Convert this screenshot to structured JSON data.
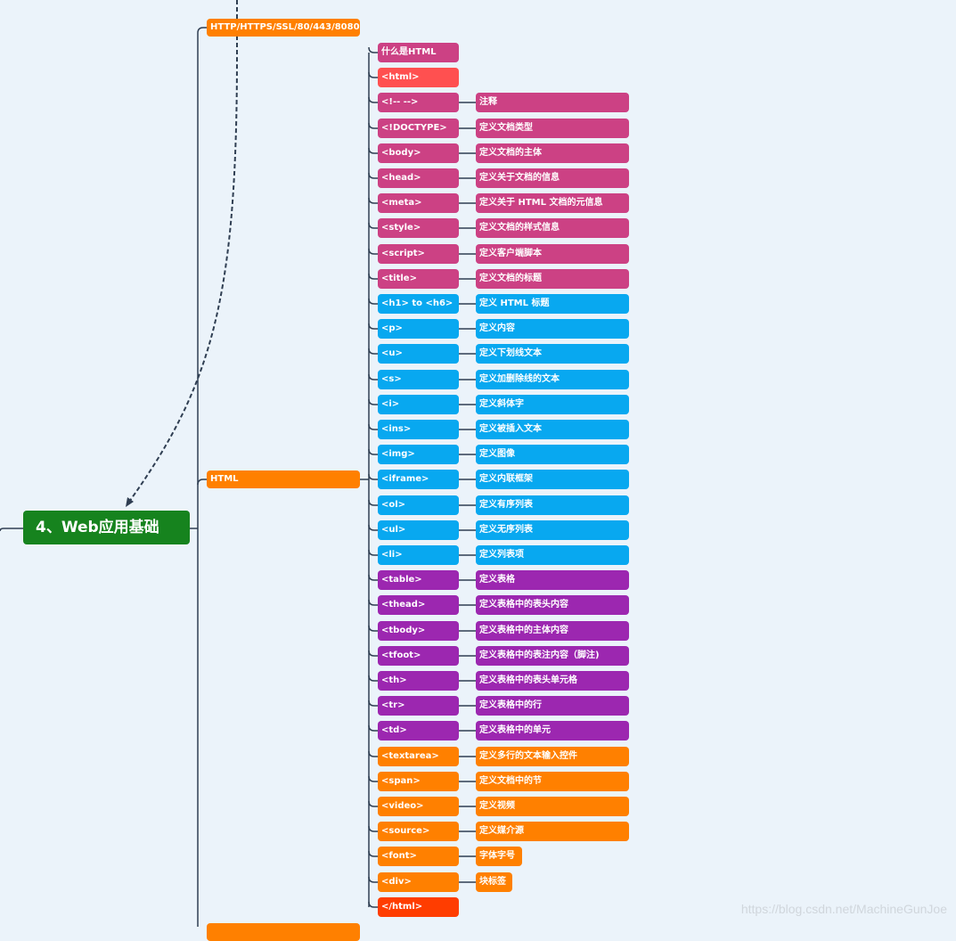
{
  "root": {
    "label": "4、Web应用基础",
    "color": "#16831e"
  },
  "colors": {
    "orange": "#ff8000",
    "pink": "#cc4184",
    "red": "#ff5050",
    "blue": "#08a8f0",
    "purple": "#9c27b0",
    "deep_red": "#ff3d00",
    "line": "#2f3e52"
  },
  "branches": [
    {
      "label": "HTTP/HTTPS/SSL/80/443/8080",
      "color": "orange"
    },
    {
      "label": "HTML",
      "color": "orange"
    },
    {
      "label": "",
      "color": "orange"
    }
  ],
  "html_children": [
    {
      "tag": "什么是HTML",
      "desc": "",
      "color": "pink"
    },
    {
      "tag": "<html>",
      "desc": "",
      "color": "red"
    },
    {
      "tag": "<!-- -->",
      "desc": "注释",
      "color": "pink"
    },
    {
      "tag": "<!DOCTYPE>",
      "desc": "定义文档类型",
      "color": "pink"
    },
    {
      "tag": "<body>",
      "desc": "定义文档的主体",
      "color": "pink"
    },
    {
      "tag": "<head>",
      "desc": "定义关于文档的信息",
      "color": "pink"
    },
    {
      "tag": "<meta>",
      "desc": "定义关于 HTML 文档的元信息",
      "color": "pink"
    },
    {
      "tag": "<style>",
      "desc": "定义文档的样式信息",
      "color": "pink"
    },
    {
      "tag": "<script>",
      "desc": "定义客户端脚本",
      "color": "pink"
    },
    {
      "tag": "<title>",
      "desc": "定义文档的标题",
      "color": "pink"
    },
    {
      "tag": "<h1> to <h6>",
      "desc": "定义 HTML 标题",
      "color": "blue"
    },
    {
      "tag": "<p>",
      "desc": "定义内容",
      "color": "blue"
    },
    {
      "tag": "<u>",
      "desc": "定义下划线文本",
      "color": "blue"
    },
    {
      "tag": "<s>",
      "desc": "定义加删除线的文本",
      "color": "blue"
    },
    {
      "tag": "<i>",
      "desc": "定义斜体字",
      "color": "blue"
    },
    {
      "tag": "<ins>",
      "desc": "定义被插入文本",
      "color": "blue"
    },
    {
      "tag": "<img>",
      "desc": "定义图像",
      "color": "blue"
    },
    {
      "tag": "<iframe>",
      "desc": "定义内联框架",
      "color": "blue"
    },
    {
      "tag": "<ol>",
      "desc": "定义有序列表",
      "color": "blue"
    },
    {
      "tag": "<ul>",
      "desc": "定义无序列表",
      "color": "blue"
    },
    {
      "tag": "<li>",
      "desc": "定义列表项",
      "color": "blue"
    },
    {
      "tag": "<table>",
      "desc": "定义表格",
      "color": "purple"
    },
    {
      "tag": "<thead>",
      "desc": "定义表格中的表头内容",
      "color": "purple"
    },
    {
      "tag": "<tbody>",
      "desc": "定义表格中的主体内容",
      "color": "purple"
    },
    {
      "tag": "<tfoot>",
      "desc": "定义表格中的表注内容（脚注)",
      "color": "purple"
    },
    {
      "tag": "<th>",
      "desc": "定义表格中的表头单元格",
      "color": "purple"
    },
    {
      "tag": "<tr>",
      "desc": "定义表格中的行",
      "color": "purple"
    },
    {
      "tag": "<td>",
      "desc": "定义表格中的单元",
      "color": "purple"
    },
    {
      "tag": "<textarea>",
      "desc": "定义多行的文本输入控件",
      "color": "orange"
    },
    {
      "tag": "<span>",
      "desc": "定义文档中的节",
      "color": "orange"
    },
    {
      "tag": "<video>",
      "desc": "定义视频",
      "color": "orange"
    },
    {
      "tag": "<source>",
      "desc": "定义媒介源",
      "color": "orange"
    },
    {
      "tag": "<font>",
      "desc": "字体字号",
      "color": "orange",
      "short": true
    },
    {
      "tag": "<div>",
      "desc": "块标签",
      "color": "orange",
      "short": true
    },
    {
      "tag": "</html>",
      "desc": "",
      "color": "deep_red"
    }
  ],
  "watermark": "https://blog.csdn.net/MachineGunJoe"
}
